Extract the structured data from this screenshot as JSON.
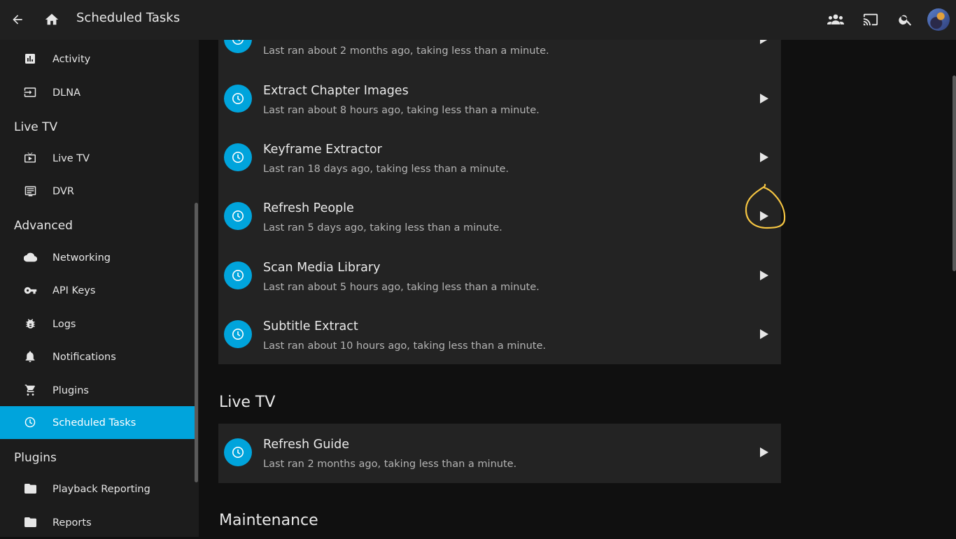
{
  "header": {
    "title": "Scheduled Tasks",
    "icons": [
      "back-arrow-icon",
      "home-icon",
      "people-icon",
      "cast-icon",
      "search-icon",
      "avatar"
    ]
  },
  "sidebar": {
    "items_top": [
      {
        "label": "Activity",
        "icon": "bar-chart-icon"
      },
      {
        "label": "DLNA",
        "icon": "input-icon"
      }
    ],
    "section_livetv": "Live TV",
    "items_livetv": [
      {
        "label": "Live TV",
        "icon": "tv-icon"
      },
      {
        "label": "DVR",
        "icon": "list-icon"
      }
    ],
    "section_advanced": "Advanced",
    "items_advanced": [
      {
        "label": "Networking",
        "icon": "cloud-icon"
      },
      {
        "label": "API Keys",
        "icon": "key-icon"
      },
      {
        "label": "Logs",
        "icon": "bug-icon"
      },
      {
        "label": "Notifications",
        "icon": "bell-icon"
      },
      {
        "label": "Plugins",
        "icon": "cart-icon"
      },
      {
        "label": "Scheduled Tasks",
        "icon": "clock-icon",
        "active": true
      }
    ],
    "section_plugins": "Plugins",
    "items_plugins": [
      {
        "label": "Playback Reporting",
        "icon": "folder-icon"
      },
      {
        "label": "Reports",
        "icon": "folder-icon"
      }
    ]
  },
  "tasks_library": [
    {
      "name": "",
      "sub": "Last ran about 2 months ago, taking less than a minute."
    },
    {
      "name": "Extract Chapter Images",
      "sub": "Last ran about 8 hours ago, taking less than a minute."
    },
    {
      "name": "Keyframe Extractor",
      "sub": "Last ran 18 days ago, taking less than a minute."
    },
    {
      "name": "Refresh People",
      "sub": "Last ran 5 days ago, taking less than a minute."
    },
    {
      "name": "Scan Media Library",
      "sub": "Last ran about 5 hours ago, taking less than a minute."
    },
    {
      "name": "Subtitle Extract",
      "sub": "Last ran about 10 hours ago, taking less than a minute."
    }
  ],
  "section_livetv_title": "Live TV",
  "tasks_livetv": [
    {
      "name": "Refresh Guide",
      "sub": "Last ran 2 months ago, taking less than a minute."
    }
  ],
  "section_maintenance_title": "Maintenance",
  "colors": {
    "accent": "#00a4dc",
    "annotation": "#f5c542"
  }
}
